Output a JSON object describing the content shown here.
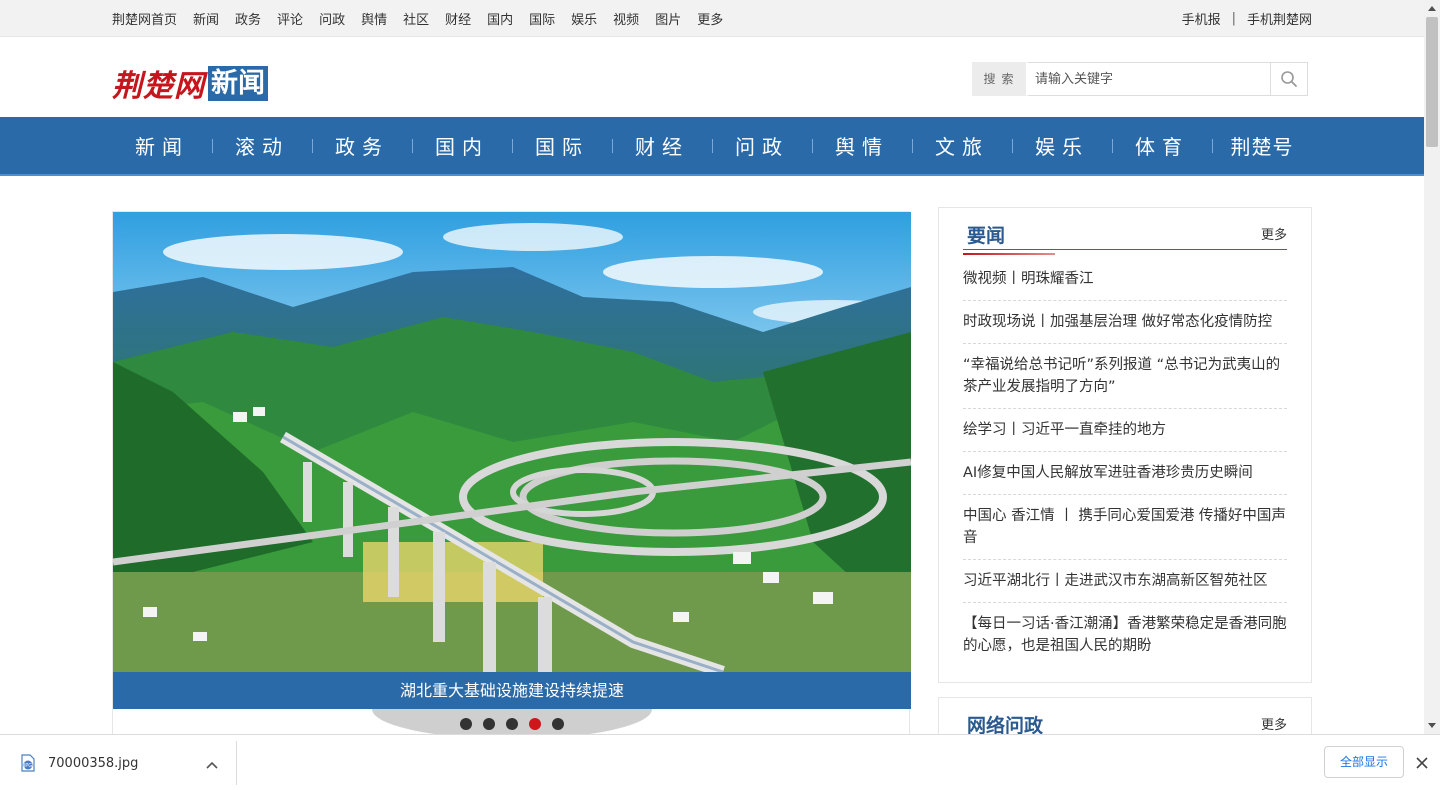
{
  "topbar": {
    "links": [
      "荆楚网首页",
      "新闻",
      "政务",
      "评论",
      "问政",
      "舆情",
      "社区",
      "财经",
      "国内",
      "国际",
      "娱乐",
      "视频",
      "图片",
      "更多"
    ],
    "right": [
      "手机报",
      "手机荆楚网"
    ],
    "separator": "|"
  },
  "header": {
    "logo_red": "荆楚网",
    "logo_box": "新闻",
    "search_label": "搜索",
    "search_placeholder": "请输入关键字"
  },
  "nav": [
    "新闻",
    "滚动",
    "政务",
    "国内",
    "国际",
    "财经",
    "问政",
    "舆情",
    "文旅",
    "娱乐",
    "体育",
    "荆楚号"
  ],
  "carousel": {
    "caption": "湖北重大基础设施建设持续提速",
    "dot_count": 5,
    "active_dot": 4
  },
  "news_panel": {
    "title": "要闻",
    "more": "更多",
    "items": [
      "微视频丨明珠耀香江",
      "时政现场说丨加强基层治理 做好常态化疫情防控",
      "“幸福说给总书记听”系列报道 “总书记为武夷山的茶产业发展指明了方向”",
      "绘学习丨习近平一直牵挂的地方",
      "AI修复中国人民解放军进驻香港珍贵历史瞬间",
      "中国心 香江情 丨 携手同心爱国爱港 传播好中国声音",
      "习近平湖北行丨走进武汉市东湖高新区智苑社区",
      "【每日一习话·香江潮涌】香港繁荣稳定是香港同胞的心愿，也是祖国人民的期盼"
    ]
  },
  "wenzheng_panel": {
    "title": "网络问政",
    "more": "更多"
  },
  "download_bar": {
    "filename": "70000358.jpg",
    "show_all": "全部显示"
  },
  "colors": {
    "nav_blue": "#2a6aa9",
    "logo_red": "#c4161c",
    "active_dot": "#d0161b",
    "link_blue": "#1a73e8"
  }
}
